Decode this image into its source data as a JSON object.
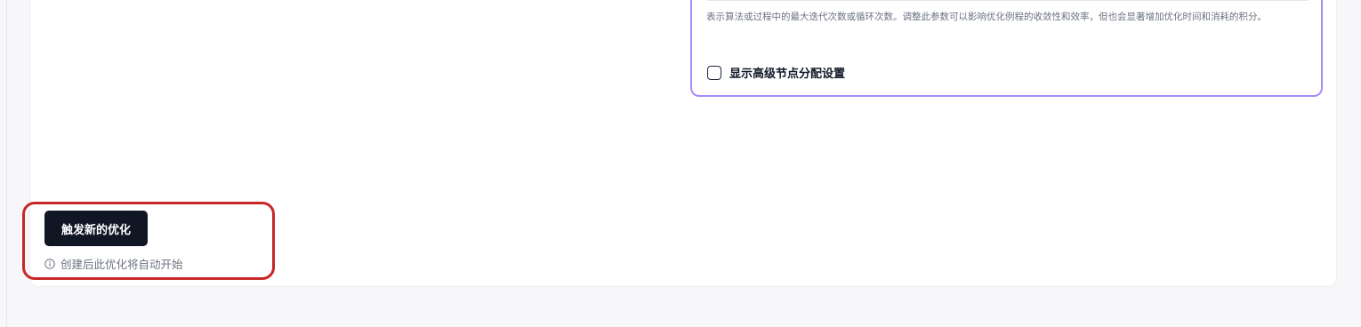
{
  "config_panel": {
    "field_description": "表示算法或过程中的最大迭代次数或循环次数。调整此参数可以影响优化例程的收敛性和效率，但也会显著增加优化时间和消耗的积分。",
    "advanced_toggle": {
      "label": "显示高级节点分配设置",
      "checked": false
    }
  },
  "actions": {
    "trigger_button_label": "触发新的优化",
    "hint_text": "创建后此优化将自动开始",
    "hint_icon": "info-circle-icon"
  },
  "colors": {
    "panel_border": "#a78bfa",
    "button_bg": "#111624",
    "highlight": "#c62828",
    "muted_text": "#6b7280"
  }
}
